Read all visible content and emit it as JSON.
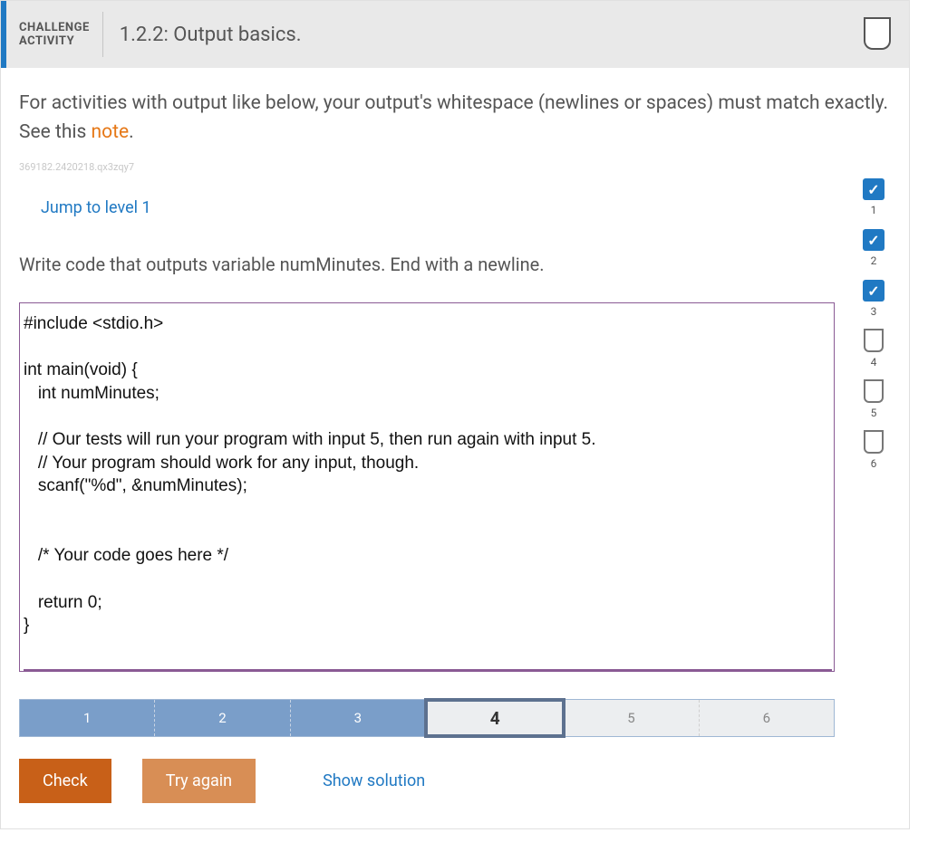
{
  "header": {
    "challenge_line1": "CHALLENGE",
    "challenge_line2": "ACTIVITY",
    "title": "1.2.2: Output basics."
  },
  "instructions": {
    "text_before_link": "For activities with output like below, your output's whitespace (newlines or spaces) must match exactly. See this ",
    "link_text": "note",
    "text_after_link": "."
  },
  "seed": "369182.2420218.qx3zqy7",
  "jump_link": "Jump to level 1",
  "prompt": "Write code that outputs variable numMinutes. End with a newline.",
  "code": "#include <stdio.h>\n\nint main(void) {\n   int numMinutes;\n\n   // Our tests will run your program with input 5, then run again with input 5.\n   // Your program should work for any input, though.\n   scanf(\"%d\", &numMinutes);\n\n\n   /* Your code goes here */\n\n   return 0;\n}",
  "levels": [
    {
      "num": "1",
      "status": "done"
    },
    {
      "num": "2",
      "status": "done"
    },
    {
      "num": "3",
      "status": "done"
    },
    {
      "num": "4",
      "status": "pending"
    },
    {
      "num": "5",
      "status": "pending"
    },
    {
      "num": "6",
      "status": "pending"
    }
  ],
  "progress": [
    {
      "label": "1",
      "state": "done"
    },
    {
      "label": "2",
      "state": "done"
    },
    {
      "label": "3",
      "state": "done"
    },
    {
      "label": "4",
      "state": "current"
    },
    {
      "label": "5",
      "state": "pending"
    },
    {
      "label": "6",
      "state": "pending"
    }
  ],
  "buttons": {
    "check": "Check",
    "try_again": "Try again",
    "show_solution": "Show solution"
  }
}
